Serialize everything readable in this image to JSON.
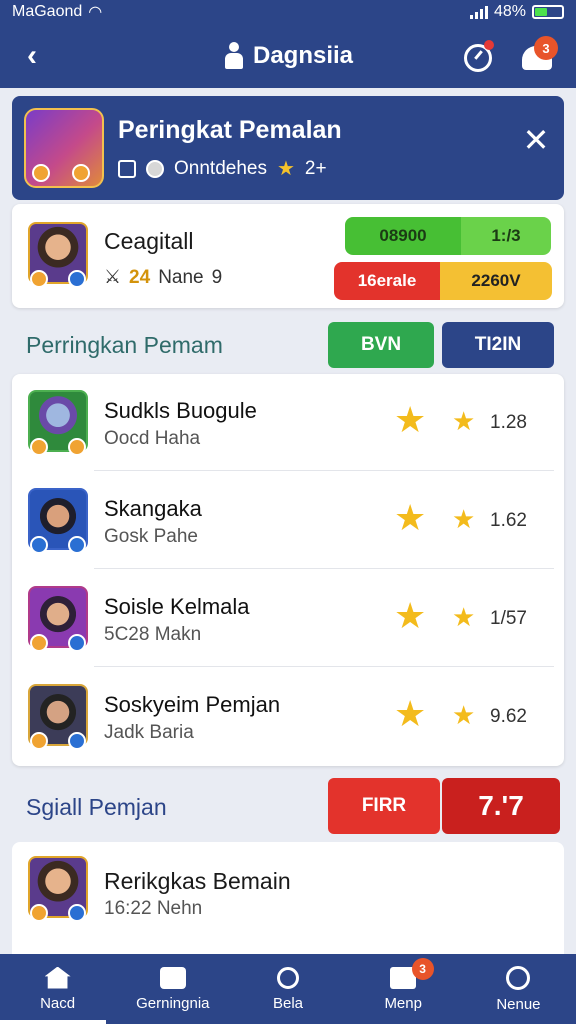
{
  "status_bar": {
    "carrier": "MaGaond",
    "battery": "48%",
    "battery_level": 0.48
  },
  "app_bar": {
    "title": "Dagnsiia",
    "notification_count": "3"
  },
  "rank_header": {
    "title": "Peringkat Pemalan",
    "subtitle": "Onntdehes",
    "stars": "2+"
  },
  "player_card": {
    "name": "Ceagitall",
    "meta_number": "24",
    "meta_text": "Nane",
    "meta_suffix": "9",
    "pill_top_left": "08900",
    "pill_top_right": "1:/3",
    "pill_bottom_left": "16erale",
    "pill_bottom_right": "2260V"
  },
  "section1": {
    "title": "Perringkan Pemam",
    "btn_left": "BVN",
    "btn_right": "TI2IN"
  },
  "rank_list": [
    {
      "name": "Sudkls Buogule",
      "sub": "Oocd Haha",
      "score": "1.28"
    },
    {
      "name": "Skangaka",
      "sub": "Gosk Pahe",
      "score": "1.62"
    },
    {
      "name": "Soisle Kelmala",
      "sub": "5C28 Makn",
      "score": "1/57"
    },
    {
      "name": "Soskyeim Pemjan",
      "sub": "Jadk Baria",
      "score": "9.62"
    }
  ],
  "section2": {
    "title": "Sgiall Pemjan",
    "btn_left": "FIRR",
    "btn_right": "7.'7"
  },
  "bottom_card": {
    "name": "Rerikgkas Bemain",
    "sub": "16:22 Nehn"
  },
  "bottom_nav": [
    {
      "label": "Nacd"
    },
    {
      "label": "Gerningnia"
    },
    {
      "label": "Bela"
    },
    {
      "label": "Menp",
      "badge": "3"
    },
    {
      "label": "Nenue"
    }
  ],
  "colors": {
    "primary": "#2c4588",
    "green": "#2fa84f",
    "red": "#e3332c",
    "gold": "#f3bb1c"
  }
}
